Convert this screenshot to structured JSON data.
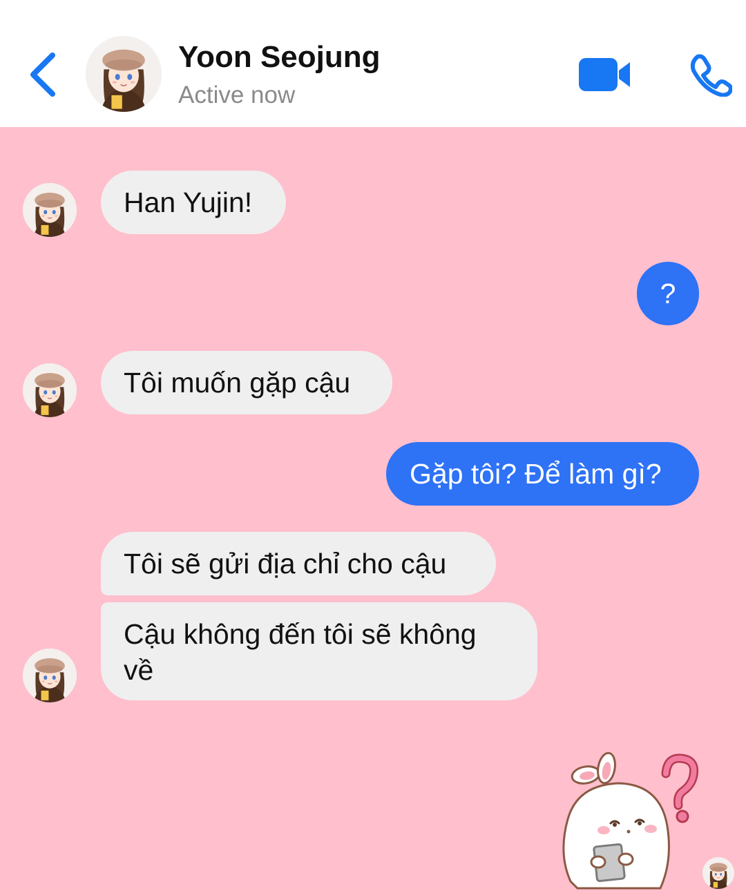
{
  "header": {
    "contact_name": "Yoon Seojung",
    "status": "Active now",
    "accent_color": "#1877f2"
  },
  "colors": {
    "chat_background": "#ffbfcd",
    "incoming_bubble": "#efefef",
    "outgoing_bubble": "#2e72f6"
  },
  "messages": [
    {
      "sender": "Yoon Seojung",
      "direction": "incoming",
      "text": "Han Yujin!"
    },
    {
      "sender": "me",
      "direction": "outgoing",
      "text": "?"
    },
    {
      "sender": "Yoon Seojung",
      "direction": "incoming",
      "text": "Tôi muốn gặp cậu"
    },
    {
      "sender": "me",
      "direction": "outgoing",
      "text": "Gặp tôi? Để làm gì?"
    },
    {
      "sender": "Yoon Seojung",
      "direction": "incoming",
      "text": "Tôi sẽ gửi địa chỉ cho cậu"
    },
    {
      "sender": "Yoon Seojung",
      "direction": "incoming",
      "text_lines": [
        "Cậu không đến tôi sẽ không",
        "về"
      ]
    }
  ],
  "sticker": {
    "description_icon": "confused-bunny-sticker"
  },
  "icons": {
    "back": "chevron-left-icon",
    "video": "video-camera-icon",
    "call": "phone-icon"
  }
}
